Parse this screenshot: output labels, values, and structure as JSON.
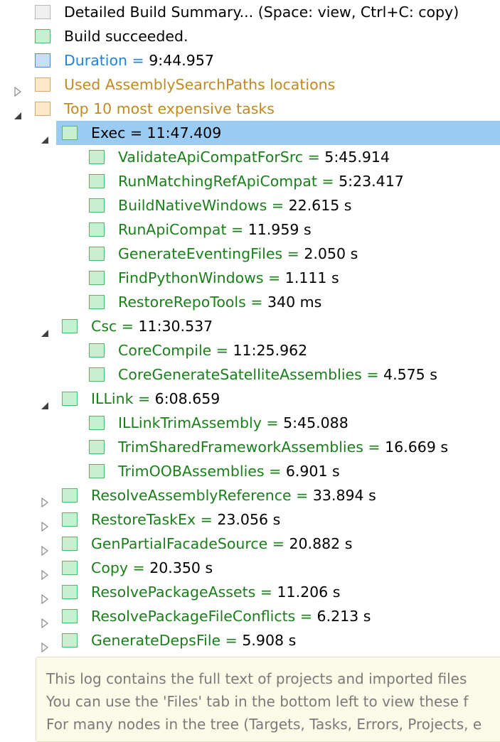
{
  "tree": [
    {
      "id": "summary",
      "indent": 0,
      "expander": "none",
      "box": "gray",
      "name": "Detailed Build Summary... (Space: view, Ctrl+C: copy)",
      "name_color": "black",
      "value": ""
    },
    {
      "id": "succeeded",
      "indent": 0,
      "expander": "none",
      "box": "green",
      "name": "Build succeeded.",
      "name_color": "black",
      "value": ""
    },
    {
      "id": "duration",
      "indent": 0,
      "expander": "none",
      "box": "blue",
      "name": "Duration = ",
      "name_color": "blue",
      "value": "9:44.957"
    },
    {
      "id": "search-paths",
      "indent": 0,
      "expander": "collapsed",
      "box": "orange",
      "name": "Used AssemblySearchPaths locations",
      "name_color": "orange",
      "value": ""
    },
    {
      "id": "top-tasks",
      "indent": 0,
      "expander": "expanded",
      "box": "orange",
      "name": "Top 10 most expensive tasks",
      "name_color": "orange",
      "value": ""
    },
    {
      "id": "exec",
      "indent": 1,
      "expander": "expanded",
      "box": "green",
      "name": "Exec = ",
      "name_color": "black",
      "value": "11:47.409",
      "selected": true
    },
    {
      "id": "validate-api",
      "indent": 2,
      "expander": "none",
      "box": "green",
      "name": "ValidateApiCompatForSrc = ",
      "name_color": "green",
      "value": "5:45.914"
    },
    {
      "id": "run-matching",
      "indent": 2,
      "expander": "none",
      "box": "green",
      "name": "RunMatchingRefApiCompat = ",
      "name_color": "green",
      "value": "5:23.417"
    },
    {
      "id": "build-native",
      "indent": 2,
      "expander": "none",
      "box": "green",
      "name": "BuildNativeWindows = ",
      "name_color": "green",
      "value": "22.615 s"
    },
    {
      "id": "run-api",
      "indent": 2,
      "expander": "none",
      "box": "green",
      "name": "RunApiCompat = ",
      "name_color": "green",
      "value": "11.959 s"
    },
    {
      "id": "gen-eventing",
      "indent": 2,
      "expander": "none",
      "box": "green",
      "name": "GenerateEventingFiles = ",
      "name_color": "green",
      "value": "2.050 s"
    },
    {
      "id": "find-python",
      "indent": 2,
      "expander": "none",
      "box": "green",
      "name": "FindPythonWindows = ",
      "name_color": "green",
      "value": "1.111 s"
    },
    {
      "id": "restore-repo",
      "indent": 2,
      "expander": "none",
      "box": "green",
      "name": "RestoreRepoTools = ",
      "name_color": "green",
      "value": "340 ms"
    },
    {
      "id": "csc",
      "indent": 1,
      "expander": "expanded",
      "box": "green",
      "name": "Csc = ",
      "name_color": "green",
      "value": "11:30.537"
    },
    {
      "id": "core-compile",
      "indent": 2,
      "expander": "none",
      "box": "green",
      "name": "CoreCompile = ",
      "name_color": "green",
      "value": "11:25.962"
    },
    {
      "id": "core-sat",
      "indent": 2,
      "expander": "none",
      "box": "green",
      "name": "CoreGenerateSatelliteAssemblies = ",
      "name_color": "green",
      "value": "4.575 s"
    },
    {
      "id": "illink",
      "indent": 1,
      "expander": "expanded",
      "box": "green",
      "name": "ILLink = ",
      "name_color": "green",
      "value": "6:08.659"
    },
    {
      "id": "illink-trim",
      "indent": 2,
      "expander": "none",
      "box": "green",
      "name": "ILLinkTrimAssembly = ",
      "name_color": "green",
      "value": "5:45.088"
    },
    {
      "id": "trim-shared",
      "indent": 2,
      "expander": "none",
      "box": "green",
      "name": "TrimSharedFrameworkAssemblies = ",
      "name_color": "green",
      "value": "16.669 s"
    },
    {
      "id": "trim-oob",
      "indent": 2,
      "expander": "none",
      "box": "green",
      "name": "TrimOOBAssemblies = ",
      "name_color": "green",
      "value": "6.901 s"
    },
    {
      "id": "resolve-asm",
      "indent": 1,
      "expander": "collapsed",
      "box": "green",
      "name": "ResolveAssemblyReference = ",
      "name_color": "green",
      "value": "33.894 s"
    },
    {
      "id": "restore-task",
      "indent": 1,
      "expander": "collapsed",
      "box": "green",
      "name": "RestoreTaskEx = ",
      "name_color": "green",
      "value": "23.056 s"
    },
    {
      "id": "gen-partial",
      "indent": 1,
      "expander": "collapsed",
      "box": "green",
      "name": "GenPartialFacadeSource = ",
      "name_color": "green",
      "value": "20.882 s"
    },
    {
      "id": "copy",
      "indent": 1,
      "expander": "collapsed",
      "box": "green",
      "name": "Copy = ",
      "name_color": "green",
      "value": "20.350 s"
    },
    {
      "id": "resolve-pkg-assets",
      "indent": 1,
      "expander": "collapsed",
      "box": "green",
      "name": "ResolvePackageAssets = ",
      "name_color": "green",
      "value": "11.206 s"
    },
    {
      "id": "resolve-pkg-conflicts",
      "indent": 1,
      "expander": "collapsed",
      "box": "green",
      "name": "ResolvePackageFileConflicts = ",
      "name_color": "green",
      "value": "6.213 s"
    },
    {
      "id": "gen-deps",
      "indent": 1,
      "expander": "collapsed",
      "box": "green",
      "name": "GenerateDepsFile = ",
      "name_color": "green",
      "value": "5.908 s"
    }
  ],
  "note": {
    "line1": "This log contains the full text of projects and imported files",
    "line2": "You can use the 'Files' tab in the bottom left to view these f",
    "line3": "For many nodes in the tree (Targets, Tasks, Errors, Projects, e"
  },
  "colors": {
    "selection": "#99cbf3",
    "green_text": "#1a7f1a",
    "blue_text": "#1f84d6",
    "orange_text": "#c08a20"
  }
}
